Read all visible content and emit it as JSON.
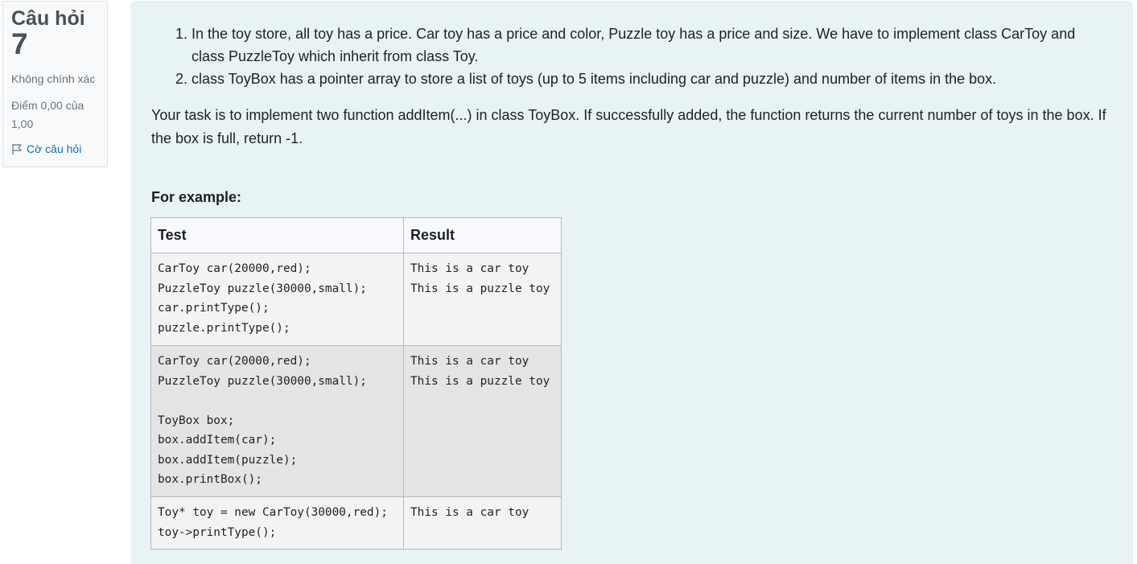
{
  "question_info": {
    "title": "Câu hỏi",
    "number": "7",
    "state": "Không chính xác",
    "grade": "Điểm 0,00 của 1,00",
    "flag_label": "Cờ câu hỏi",
    "flag_icon": "flag-icon"
  },
  "question": {
    "list_items": [
      "In the toy store, all toy has a price. Car toy has a price and color, Puzzle toy has a price and size. We have to implement class CarToy and class PuzzleToy which inherit from class Toy.",
      "class ToyBox has a  pointer array to store a list of toys (up to 5 items including car and puzzle) and number of items in the box."
    ],
    "task": "Your task is to implement two function addItem(...) in class ToyBox. If successfully added, the function returns the current number of toys in the box. If the box is full, return -1.",
    "example_label": "For example:"
  },
  "examples_table": {
    "headers": [
      "Test",
      "Result"
    ],
    "rows": [
      {
        "test": "CarToy car(20000,red);\nPuzzleToy puzzle(30000,small);\ncar.printType();\npuzzle.printType();",
        "result": "This is a car toy\nThis is a puzzle toy"
      },
      {
        "test": "CarToy car(20000,red);\nPuzzleToy puzzle(30000,small);\n\nToyBox box;\nbox.addItem(car);\nbox.addItem(puzzle);\nbox.printBox();",
        "result": "This is a car toy\nThis is a puzzle toy"
      },
      {
        "test": "Toy* toy = new CarToy(30000,red);\ntoy->printType();",
        "result": "This is a car toy"
      }
    ]
  }
}
